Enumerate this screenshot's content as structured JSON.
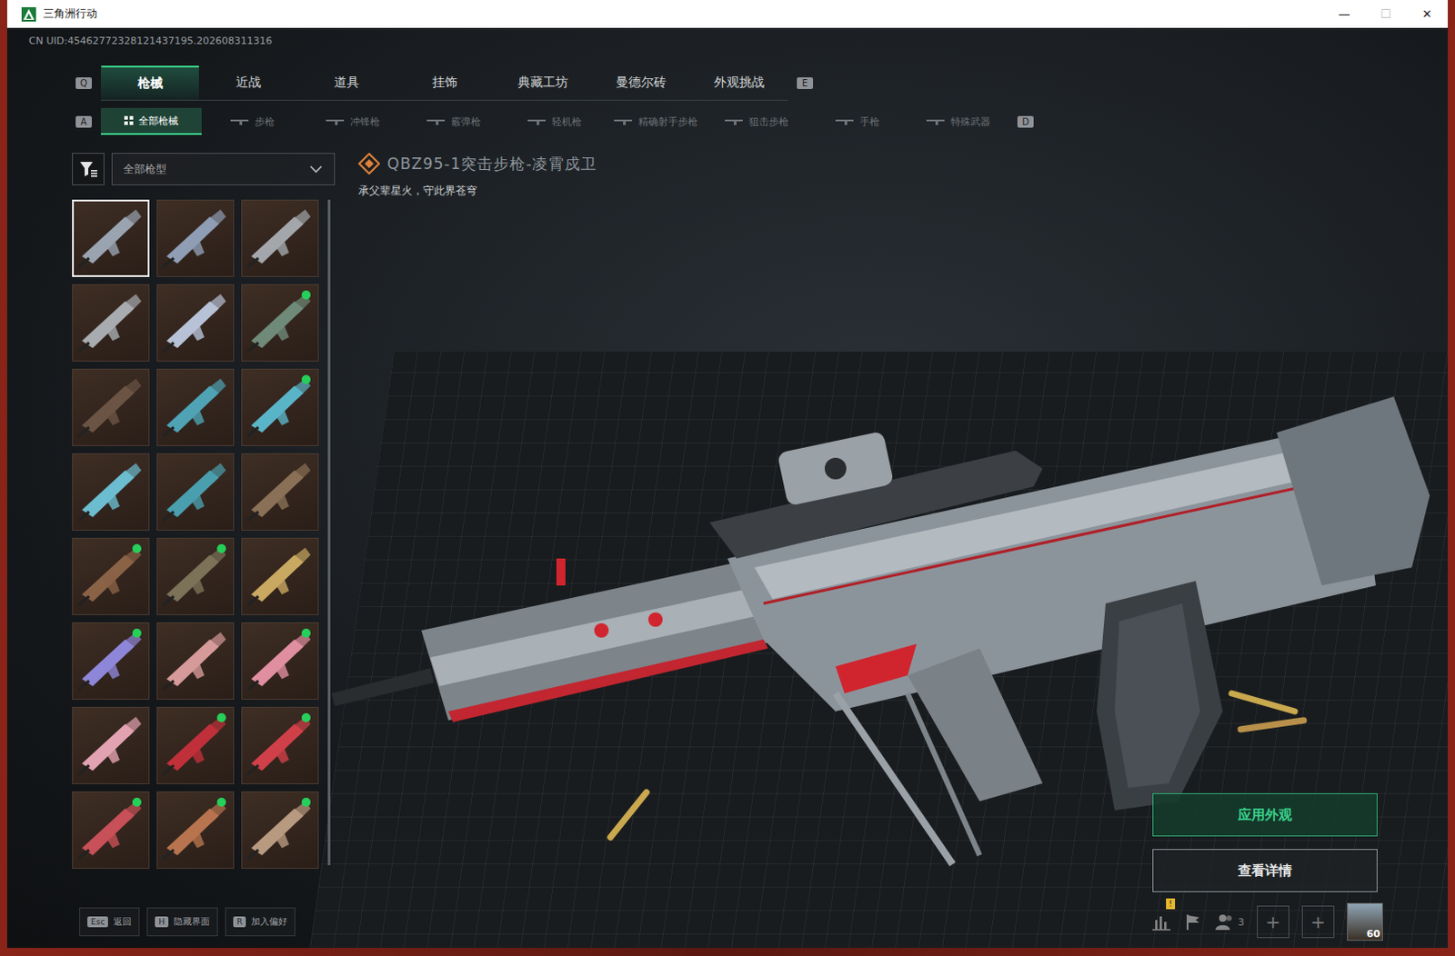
{
  "window": {
    "title": "三角洲行动",
    "controls": [
      "—",
      "☐",
      "✕"
    ]
  },
  "uid": "CN UID:45462772328121437195.202608311316",
  "main_tabs": {
    "prev_key": "Q",
    "next_key": "E",
    "items": [
      {
        "label": "枪械",
        "selected": true
      },
      {
        "label": "近战",
        "selected": false
      },
      {
        "label": "道具",
        "selected": false
      },
      {
        "label": "挂饰",
        "selected": false
      },
      {
        "label": "典藏工坊",
        "selected": false
      },
      {
        "label": "曼德尔砖",
        "selected": false
      },
      {
        "label": "外观挑战",
        "selected": false
      }
    ]
  },
  "sub_tabs": {
    "prev_key": "A",
    "next_key": "D",
    "items": [
      {
        "label": "全部枪械",
        "selected": true
      },
      {
        "label": "步枪",
        "selected": false
      },
      {
        "label": "冲锋枪",
        "selected": false
      },
      {
        "label": "霰弹枪",
        "selected": false
      },
      {
        "label": "轻机枪",
        "selected": false
      },
      {
        "label": "精确射手步枪",
        "selected": false
      },
      {
        "label": "狙击步枪",
        "selected": false
      },
      {
        "label": "手枪",
        "selected": false
      },
      {
        "label": "特殊武器",
        "selected": false
      }
    ]
  },
  "filter": {
    "value": "全部枪型"
  },
  "skins": [
    {
      "selected": true,
      "owned": false,
      "color": "#9aa4b0"
    },
    {
      "selected": false,
      "owned": false,
      "color": "#8f9db5"
    },
    {
      "selected": false,
      "owned": false,
      "color": "#a3a7ab"
    },
    {
      "selected": false,
      "owned": false,
      "color": "#a8acb0"
    },
    {
      "selected": false,
      "owned": false,
      "color": "#b8c2d6"
    },
    {
      "selected": false,
      "owned": true,
      "color": "#6f8a78"
    },
    {
      "selected": false,
      "owned": false,
      "color": "#6b5444"
    },
    {
      "selected": false,
      "owned": false,
      "color": "#4fa3b5"
    },
    {
      "selected": false,
      "owned": true,
      "color": "#5ab4c8"
    },
    {
      "selected": false,
      "owned": false,
      "color": "#6cbdd0"
    },
    {
      "selected": false,
      "owned": false,
      "color": "#4a9fae"
    },
    {
      "selected": false,
      "owned": false,
      "color": "#8a7056"
    },
    {
      "selected": false,
      "owned": true,
      "color": "#8a6246"
    },
    {
      "selected": false,
      "owned": true,
      "color": "#7c7258"
    },
    {
      "selected": false,
      "owned": false,
      "color": "#c9a862"
    },
    {
      "selected": false,
      "owned": true,
      "color": "#8e86d8"
    },
    {
      "selected": false,
      "owned": false,
      "color": "#d79a9a"
    },
    {
      "selected": false,
      "owned": true,
      "color": "#e08fa0"
    },
    {
      "selected": false,
      "owned": false,
      "color": "#e2a2b2"
    },
    {
      "selected": false,
      "owned": true,
      "color": "#c0303a"
    },
    {
      "selected": false,
      "owned": true,
      "color": "#d04048"
    },
    {
      "selected": false,
      "owned": true,
      "color": "#c85058"
    },
    {
      "selected": false,
      "owned": true,
      "color": "#b8744e"
    },
    {
      "selected": false,
      "owned": true,
      "color": "#b89a80"
    }
  ],
  "weapon": {
    "name": "QBZ95-1突击步枪-凌霄戍卫",
    "motto": "承父辈星火，守此界苍穹"
  },
  "buttons": [
    {
      "label": "应用外观",
      "primary": true
    },
    {
      "label": "查看详情",
      "primary": false
    }
  ],
  "hints": [
    {
      "key": "Esc",
      "label": "返回"
    },
    {
      "key": "H",
      "label": "隐藏界面"
    },
    {
      "key": "R",
      "label": "加入偏好"
    }
  ],
  "status": {
    "stats_badge": "!",
    "friends": "3",
    "slots": [
      "+",
      "+"
    ],
    "level": "60"
  }
}
